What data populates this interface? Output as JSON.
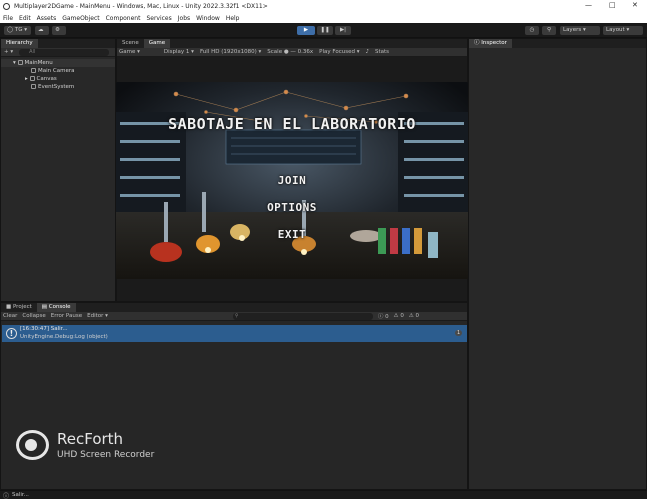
{
  "window": {
    "title": "Multiplayer2DGame - MainMenu - Windows, Mac, Linux - Unity 2022.3.32f1 <DX11>",
    "min_icon": "minimize-icon",
    "max_icon": "maximize-icon",
    "close_icon": "close-icon"
  },
  "menu": [
    "File",
    "Edit",
    "Assets",
    "GameObject",
    "Component",
    "Services",
    "Jobs",
    "Window",
    "Help"
  ],
  "toolbar": {
    "account_label": "TG",
    "layers_label": "Layers",
    "layout_label": "Layout"
  },
  "hierarchy": {
    "tab": "Hierarchy",
    "search_placeholder": "All",
    "scene_name": "MainMenu",
    "items": [
      "Main Camera",
      "Canvas",
      "EventSystem"
    ]
  },
  "center_tabs": {
    "scene": "Scene",
    "game": "Game"
  },
  "game_bar": {
    "mode": "Game",
    "display": "Display 1",
    "resolution": "Full HD (1920x1080)",
    "scale_label": "Scale",
    "scale_value": "0.36x",
    "play_focused": "Play Focused",
    "stats": "Stats"
  },
  "game": {
    "title": "SABOTAJE EN EL LABORATORIO",
    "join": "JOIN",
    "options": "OPTIONS",
    "exit": "EXIT"
  },
  "inspector": {
    "tab": "Inspector"
  },
  "bottom_tabs": {
    "project": "Project",
    "console": "Console"
  },
  "console_bar": {
    "clear": "Clear",
    "collapse": "Collapse",
    "error_pause": "Error Pause",
    "editor": "Editor",
    "count_info": "0",
    "count_warn": "0",
    "count_error": "0"
  },
  "console_entry": {
    "line1": "[16:30:47] Salir...",
    "line2": "UnityEngine.Debug:Log (object)",
    "count": "1"
  },
  "watermark": {
    "brand": "RecForth",
    "subtitle": "UHD Screen Recorder"
  },
  "status": {
    "text": "Salir..."
  },
  "colors": {
    "accent": "#2c5d8f",
    "play_button": "#3e6ea8"
  }
}
